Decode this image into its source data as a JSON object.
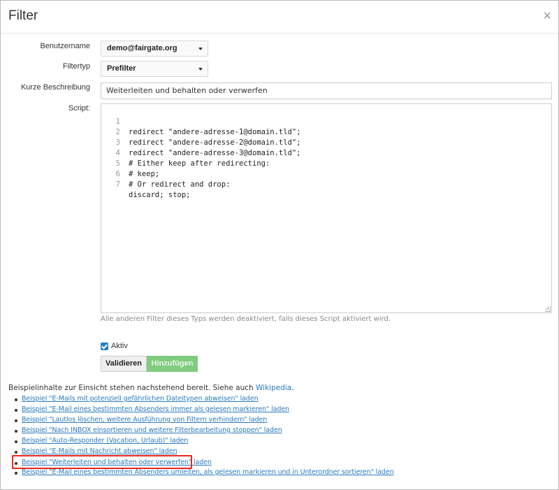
{
  "dialog": {
    "title": "Filter",
    "close_label": "×"
  },
  "form": {
    "username_label": "Benutzername",
    "username_value": "demo@fairgate.org",
    "filtertype_label": "Filtertyp",
    "filtertype_value": "Prefilter",
    "description_label": "Kurze Beschreibung",
    "description_value": "Weiterleiten und behalten oder verwerfen",
    "script_label": "Script:",
    "script_lines": [
      {
        "no": "1",
        "code": "redirect \"andere-adresse-1@domain.tld\";"
      },
      {
        "no": "2",
        "code": "redirect \"andere-adresse-2@domain.tld\";"
      },
      {
        "no": "3",
        "code": "redirect \"andere-adresse-3@domain.tld\";"
      },
      {
        "no": "4",
        "code": "# Either keep after redirecting:"
      },
      {
        "no": "5",
        "code": "# keep;"
      },
      {
        "no": "6",
        "code": "# Or redirect and drop:"
      },
      {
        "no": "7",
        "code": "discard; stop;"
      }
    ],
    "script_help": "Alle anderen Filter dieses Typs werden deaktiviert, falls dieses Script aktiviert wird.",
    "active_label": "Aktiv",
    "active_checked": true,
    "validate_button": "Validieren",
    "add_button": "Hinzufügen"
  },
  "examples": {
    "intro_text": "Beispielinhalte zur Einsicht stehen nachstehend bereit. Siehe auch ",
    "intro_link": "Wikipedia",
    "intro_end": ".",
    "items": [
      "Beispiel \"E-Mails mit potenziell gefährlichen Dateitypen abweisen\" laden",
      "Beispiel \"E-Mail eines bestimmten Absenders immer als gelesen markieren\" laden",
      "Beispiel \"Lautlos löschen, weitere Ausführung von Filtern verhindern\" laden",
      "Beispiel \"Nach INBOX einsortieren und weitere Filterbearbeitung stoppen\" laden",
      "Beispiel \"Auto-Responder (Vacation, Urlaub)\" laden",
      "Beispiel \"E-Mails mit Nachricht abweisen\" laden",
      "Beispiel \"Weiterleiten und behalten oder verwerfen\" laden",
      "Beispiel \"E-Mail eines bestimmten Absenders umleiten, als gelesen markieren und in Unterordner sortieren\" laden"
    ],
    "highlighted_index": 6
  },
  "colors": {
    "link": "#2a7abf",
    "checkbox": "#2b7ec1",
    "add_button": "#7fcc7f",
    "highlight": "#e8291c"
  }
}
